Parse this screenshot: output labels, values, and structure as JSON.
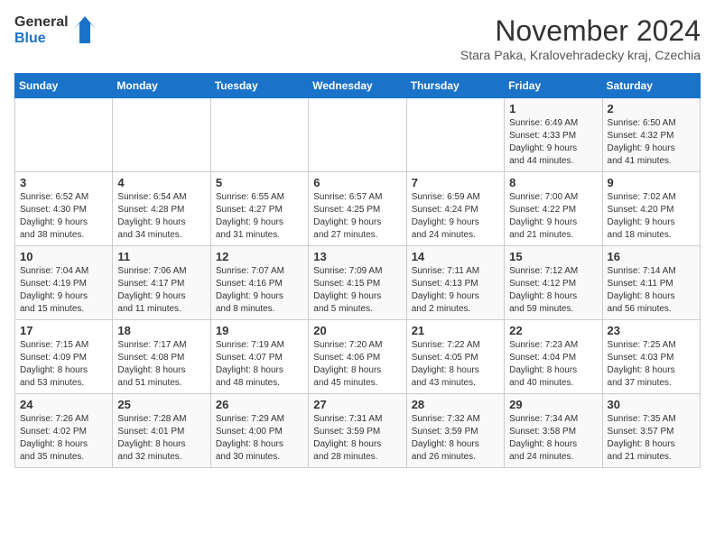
{
  "logo": {
    "line1": "General",
    "line2": "Blue"
  },
  "header": {
    "month_year": "November 2024",
    "location": "Stara Paka, Kralovehradecky kraj, Czechia"
  },
  "days_of_week": [
    "Sunday",
    "Monday",
    "Tuesday",
    "Wednesday",
    "Thursday",
    "Friday",
    "Saturday"
  ],
  "weeks": [
    [
      {
        "day": "",
        "info": ""
      },
      {
        "day": "",
        "info": ""
      },
      {
        "day": "",
        "info": ""
      },
      {
        "day": "",
        "info": ""
      },
      {
        "day": "",
        "info": ""
      },
      {
        "day": "1",
        "info": "Sunrise: 6:49 AM\nSunset: 4:33 PM\nDaylight: 9 hours\nand 44 minutes."
      },
      {
        "day": "2",
        "info": "Sunrise: 6:50 AM\nSunset: 4:32 PM\nDaylight: 9 hours\nand 41 minutes."
      }
    ],
    [
      {
        "day": "3",
        "info": "Sunrise: 6:52 AM\nSunset: 4:30 PM\nDaylight: 9 hours\nand 38 minutes."
      },
      {
        "day": "4",
        "info": "Sunrise: 6:54 AM\nSunset: 4:28 PM\nDaylight: 9 hours\nand 34 minutes."
      },
      {
        "day": "5",
        "info": "Sunrise: 6:55 AM\nSunset: 4:27 PM\nDaylight: 9 hours\nand 31 minutes."
      },
      {
        "day": "6",
        "info": "Sunrise: 6:57 AM\nSunset: 4:25 PM\nDaylight: 9 hours\nand 27 minutes."
      },
      {
        "day": "7",
        "info": "Sunrise: 6:59 AM\nSunset: 4:24 PM\nDaylight: 9 hours\nand 24 minutes."
      },
      {
        "day": "8",
        "info": "Sunrise: 7:00 AM\nSunset: 4:22 PM\nDaylight: 9 hours\nand 21 minutes."
      },
      {
        "day": "9",
        "info": "Sunrise: 7:02 AM\nSunset: 4:20 PM\nDaylight: 9 hours\nand 18 minutes."
      }
    ],
    [
      {
        "day": "10",
        "info": "Sunrise: 7:04 AM\nSunset: 4:19 PM\nDaylight: 9 hours\nand 15 minutes."
      },
      {
        "day": "11",
        "info": "Sunrise: 7:06 AM\nSunset: 4:17 PM\nDaylight: 9 hours\nand 11 minutes."
      },
      {
        "day": "12",
        "info": "Sunrise: 7:07 AM\nSunset: 4:16 PM\nDaylight: 9 hours\nand 8 minutes."
      },
      {
        "day": "13",
        "info": "Sunrise: 7:09 AM\nSunset: 4:15 PM\nDaylight: 9 hours\nand 5 minutes."
      },
      {
        "day": "14",
        "info": "Sunrise: 7:11 AM\nSunset: 4:13 PM\nDaylight: 9 hours\nand 2 minutes."
      },
      {
        "day": "15",
        "info": "Sunrise: 7:12 AM\nSunset: 4:12 PM\nDaylight: 8 hours\nand 59 minutes."
      },
      {
        "day": "16",
        "info": "Sunrise: 7:14 AM\nSunset: 4:11 PM\nDaylight: 8 hours\nand 56 minutes."
      }
    ],
    [
      {
        "day": "17",
        "info": "Sunrise: 7:15 AM\nSunset: 4:09 PM\nDaylight: 8 hours\nand 53 minutes."
      },
      {
        "day": "18",
        "info": "Sunrise: 7:17 AM\nSunset: 4:08 PM\nDaylight: 8 hours\nand 51 minutes."
      },
      {
        "day": "19",
        "info": "Sunrise: 7:19 AM\nSunset: 4:07 PM\nDaylight: 8 hours\nand 48 minutes."
      },
      {
        "day": "20",
        "info": "Sunrise: 7:20 AM\nSunset: 4:06 PM\nDaylight: 8 hours\nand 45 minutes."
      },
      {
        "day": "21",
        "info": "Sunrise: 7:22 AM\nSunset: 4:05 PM\nDaylight: 8 hours\nand 43 minutes."
      },
      {
        "day": "22",
        "info": "Sunrise: 7:23 AM\nSunset: 4:04 PM\nDaylight: 8 hours\nand 40 minutes."
      },
      {
        "day": "23",
        "info": "Sunrise: 7:25 AM\nSunset: 4:03 PM\nDaylight: 8 hours\nand 37 minutes."
      }
    ],
    [
      {
        "day": "24",
        "info": "Sunrise: 7:26 AM\nSunset: 4:02 PM\nDaylight: 8 hours\nand 35 minutes."
      },
      {
        "day": "25",
        "info": "Sunrise: 7:28 AM\nSunset: 4:01 PM\nDaylight: 8 hours\nand 32 minutes."
      },
      {
        "day": "26",
        "info": "Sunrise: 7:29 AM\nSunset: 4:00 PM\nDaylight: 8 hours\nand 30 minutes."
      },
      {
        "day": "27",
        "info": "Sunrise: 7:31 AM\nSunset: 3:59 PM\nDaylight: 8 hours\nand 28 minutes."
      },
      {
        "day": "28",
        "info": "Sunrise: 7:32 AM\nSunset: 3:59 PM\nDaylight: 8 hours\nand 26 minutes."
      },
      {
        "day": "29",
        "info": "Sunrise: 7:34 AM\nSunset: 3:58 PM\nDaylight: 8 hours\nand 24 minutes."
      },
      {
        "day": "30",
        "info": "Sunrise: 7:35 AM\nSunset: 3:57 PM\nDaylight: 8 hours\nand 21 minutes."
      }
    ]
  ]
}
